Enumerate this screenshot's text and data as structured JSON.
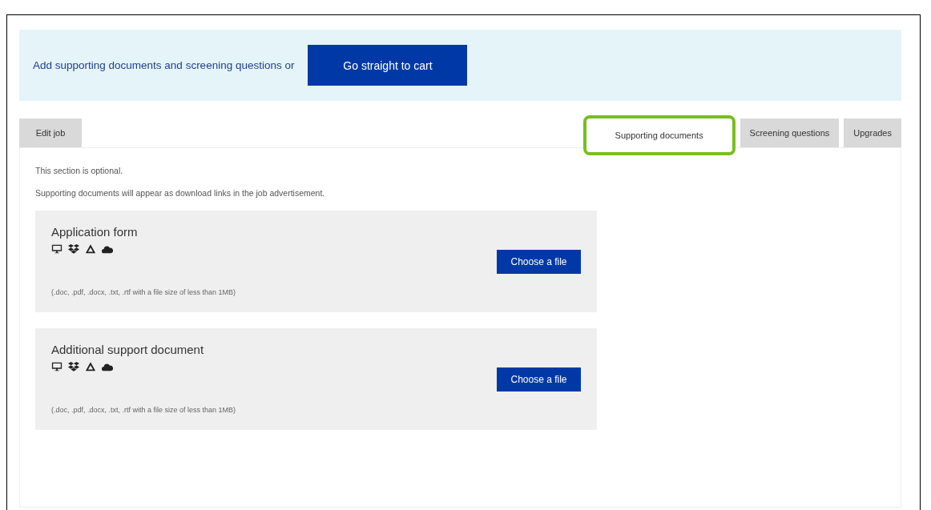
{
  "banner": {
    "text": "Add supporting documents and screening questions or",
    "button": "Go straight to cart"
  },
  "tabs": [
    {
      "label": "Edit job",
      "selected": false,
      "highlighted": false
    },
    {
      "label": "Supporting documents",
      "selected": true,
      "highlighted": true
    },
    {
      "label": "Screening questions",
      "selected": false,
      "highlighted": false
    },
    {
      "label": "Upgrades",
      "selected": false,
      "highlighted": false
    }
  ],
  "notes": [
    "This section is optional.",
    "Supporting documents will appear as download links in the job advertisement."
  ],
  "uploads": [
    {
      "title": "Application form",
      "button": "Choose a file",
      "hint": "(.doc, .pdf, .docx, .txt, .rtf with a file size of less than 1MB)"
    },
    {
      "title": "Additional support document",
      "button": "Choose a file",
      "hint": "(.doc, .pdf, .docx, .txt, .rtf with a file size of less than 1MB)"
    }
  ]
}
